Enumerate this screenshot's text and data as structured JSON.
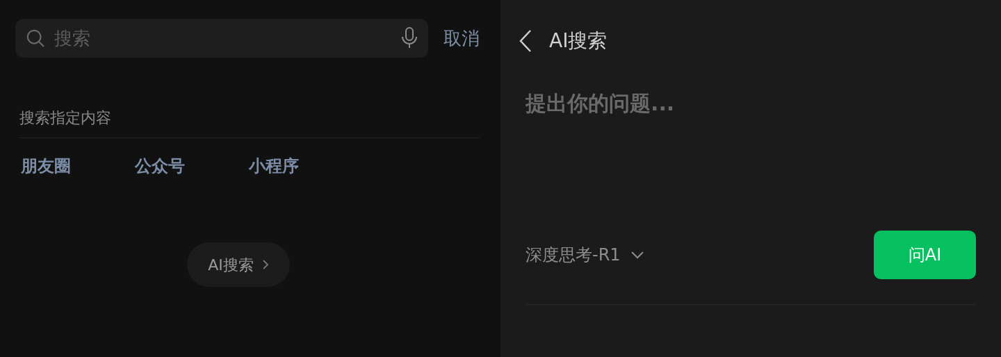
{
  "search_page": {
    "search": {
      "placeholder": "搜索"
    },
    "cancel": "取消",
    "section_title": "搜索指定内容",
    "filters": [
      {
        "label": "朋友圈"
      },
      {
        "label": "公众号"
      },
      {
        "label": "小程序"
      }
    ],
    "ai_entry": "AI搜索"
  },
  "ai_page": {
    "title": "AI搜索",
    "question": {
      "placeholder": "提出你的问题..."
    },
    "model": "深度思考-R1",
    "ask_button": "问AI"
  }
}
